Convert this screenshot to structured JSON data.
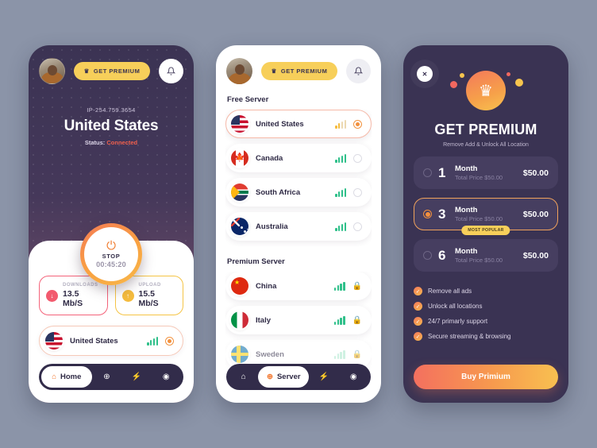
{
  "screen1": {
    "header": {
      "premium_label": "GET PREMIUM",
      "crown_icon": "crown-icon",
      "bell_icon": "bell-icon",
      "avatar": "user-avatar"
    },
    "ip": "IP-254.759.3654",
    "country": "United States",
    "status_label": "Status:",
    "status_value": "Connected",
    "power": {
      "icon": "power-icon",
      "label": "STOP",
      "timer": "00:45:20"
    },
    "speed": {
      "download": {
        "label": "DOWNLOADS",
        "value": "13.5 Mb/S",
        "icon": "arrow-down-icon",
        "color": "#f25a6e"
      },
      "upload": {
        "label": "UPLOAD",
        "value": "15.5 Mb/S",
        "icon": "arrow-up-icon",
        "color": "#f5bc3e"
      }
    },
    "selected_location": "United States",
    "nav": [
      {
        "label": "Home",
        "icon": "home-icon",
        "active": true
      },
      {
        "label": "",
        "icon": "globe-icon",
        "active": false
      },
      {
        "label": "",
        "icon": "bolt-icon",
        "active": false
      },
      {
        "label": "",
        "icon": "settings-icon",
        "active": false
      }
    ]
  },
  "screen2": {
    "header": {
      "premium_label": "GET PREMIUM",
      "crown_icon": "crown-icon",
      "bell_icon": "bell-icon",
      "avatar": "user-avatar"
    },
    "free_section": "Free Server",
    "free_servers": [
      {
        "name": "United States",
        "flag": "fl-us",
        "selected": true,
        "signal": "amber",
        "state": "radio-selected"
      },
      {
        "name": "Canada",
        "flag": "fl-ca",
        "selected": false,
        "signal": "green",
        "state": "radio-empty"
      },
      {
        "name": "South Africa",
        "flag": "fl-za",
        "selected": false,
        "signal": "green",
        "state": "radio-empty"
      },
      {
        "name": "Australia",
        "flag": "fl-au",
        "selected": false,
        "signal": "green",
        "state": "radio-empty"
      }
    ],
    "premium_section": "Premium Server",
    "premium_servers": [
      {
        "name": "China",
        "flag": "fl-cn",
        "signal": "green",
        "state": "locked"
      },
      {
        "name": "Italy",
        "flag": "fl-it",
        "signal": "green",
        "state": "locked"
      },
      {
        "name": "Sweden",
        "flag": "fl-se",
        "signal": "pale",
        "state": "locked"
      }
    ],
    "nav": [
      {
        "label": "",
        "icon": "home-icon",
        "active": false
      },
      {
        "label": "Server",
        "icon": "globe-icon",
        "active": true
      },
      {
        "label": "",
        "icon": "bolt-icon",
        "active": false
      },
      {
        "label": "",
        "icon": "settings-icon",
        "active": false
      }
    ]
  },
  "screen3": {
    "close_icon": "close-icon",
    "crown_icon": "crown-icon",
    "title": "GET PREMIUM",
    "subtitle": "Remove Add & Unlock All Location",
    "plans": [
      {
        "num": "1",
        "unit": "Month",
        "total": "Total Price $50.00",
        "price": "$50.00",
        "selected": false,
        "badge": ""
      },
      {
        "num": "3",
        "unit": "Month",
        "total": "Total Price $50.00",
        "price": "$50.00",
        "selected": true,
        "badge": "MOST POPULAR"
      },
      {
        "num": "6",
        "unit": "Month",
        "total": "Total Price $50.00",
        "price": "$50.00",
        "selected": false,
        "badge": ""
      }
    ],
    "features": [
      "Remove all ads",
      "Unlock all locations",
      "24/7 primarly support",
      "Secure streaming & browsing"
    ],
    "buy_label": "Buy Primium"
  },
  "colors": {
    "dark_purple": "#3a3353",
    "card_purple": "#463e60",
    "accent_orange": "#f2903e",
    "accent_yellow": "#f7cf5a",
    "accent_red": "#f0604d",
    "signal_green": "#2fc08a"
  }
}
